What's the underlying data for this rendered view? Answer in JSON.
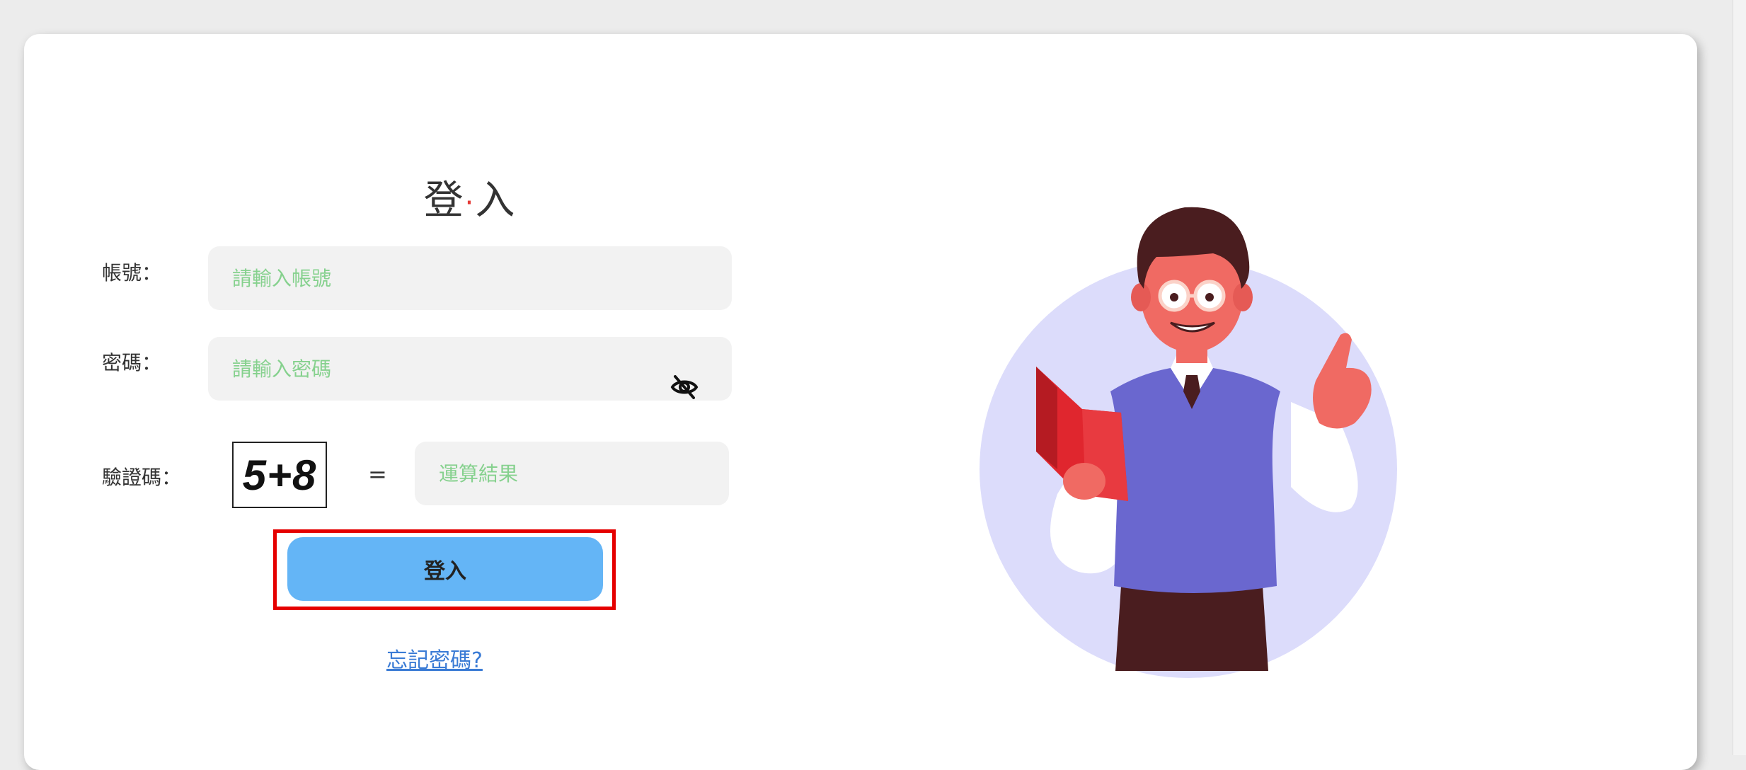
{
  "login": {
    "title_left": "登",
    "title_dot": "·",
    "title_right": "入",
    "account_label": "帳號：",
    "account_placeholder": "請輸入帳號",
    "password_label": "密碼：",
    "password_placeholder": "請輸入密碼",
    "password_toggle_icon": "eye-slash-icon",
    "captcha_label": "驗證碼：",
    "captcha_text": "5+8",
    "equals_sign": "=",
    "captcha_answer_placeholder": "運算結果",
    "submit_label": "登入",
    "forgot_label": "忘記密碼?"
  },
  "illustration": {
    "subject": "teacher-holding-book-raising-finger"
  },
  "colors": {
    "button_bg": "#64b5f6",
    "highlight_outline": "#e50000",
    "placeholder": "#86d18e",
    "link": "#3a7bd5",
    "illustration_circle": "#dcdcfb",
    "vest": "#6a67cf",
    "book": "#e0262e"
  }
}
